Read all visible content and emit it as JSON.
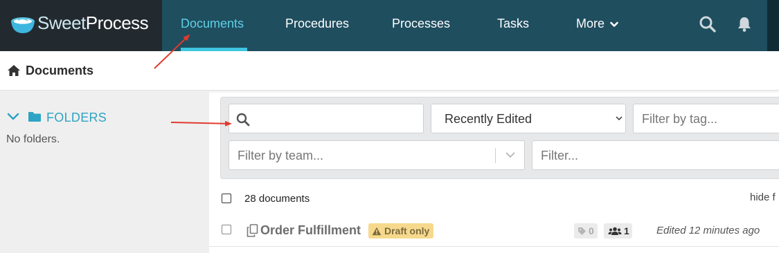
{
  "app": {
    "brand_part1": "Sweet",
    "brand_part2": "Process"
  },
  "nav": {
    "items": [
      {
        "label": "Documents",
        "active": true
      },
      {
        "label": "Procedures"
      },
      {
        "label": "Processes"
      },
      {
        "label": "Tasks"
      },
      {
        "label": "More",
        "has_dropdown": true
      }
    ],
    "icons": [
      "search-icon",
      "bell-icon"
    ]
  },
  "breadcrumb": {
    "title": "Documents",
    "icon": "home-icon"
  },
  "sidebar": {
    "folders_label": "FOLDERS",
    "empty_text": "No folders."
  },
  "filters": {
    "search_value": "",
    "sort_selected": "Recently Edited",
    "tag_placeholder": "Filter by tag...",
    "team_placeholder": "Filter by team...",
    "filter_placeholder": "Filter..."
  },
  "list": {
    "count_label": "28 documents",
    "hide_link": "hide f",
    "rows": [
      {
        "title": "Order Fulfillment",
        "badge": "Draft only",
        "tag_count": "0",
        "team_count": "1",
        "edited": "Edited 12 minutes ago"
      }
    ]
  },
  "colors": {
    "topbar": "#1f4e5f",
    "logo_bg": "#222a30",
    "active_nav": "#5fd0e6",
    "accent": "#2da4c4",
    "draft_badge": "#f6d98c",
    "annotation_arrow": "#e03a2f"
  }
}
